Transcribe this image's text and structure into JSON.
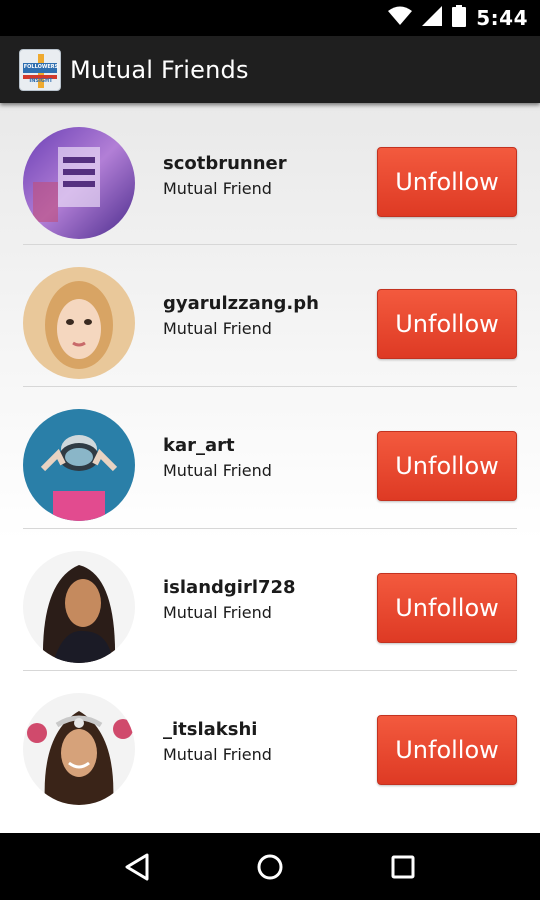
{
  "status_bar": {
    "time": "5:44",
    "icons": [
      "wifi-icon",
      "signal-icon",
      "battery-icon"
    ]
  },
  "app_bar": {
    "title": "Mutual Friends",
    "logo_icon": "followers-insight-logo",
    "logo_text_top": "FOLLOWERS",
    "logo_text_bottom": "INSIGHT"
  },
  "friends": [
    {
      "username": "scotbrunner",
      "subtitle": "Mutual Friend",
      "button_label": "Unfollow"
    },
    {
      "username": "gyarulzzang.ph",
      "subtitle": "Mutual Friend",
      "button_label": "Unfollow"
    },
    {
      "username": "kar_art",
      "subtitle": "Mutual Friend",
      "button_label": "Unfollow"
    },
    {
      "username": "islandgirl728",
      "subtitle": "Mutual Friend",
      "button_label": "Unfollow"
    },
    {
      "username": "_itslakshi",
      "subtitle": "Mutual Friend",
      "button_label": "Unfollow"
    }
  ],
  "nav_bar": {
    "icons": [
      "back-icon",
      "home-icon",
      "recents-icon"
    ]
  },
  "colors": {
    "accent": "#e8432c",
    "app_bar": "#1f1f1f",
    "status_bar": "#000000"
  }
}
